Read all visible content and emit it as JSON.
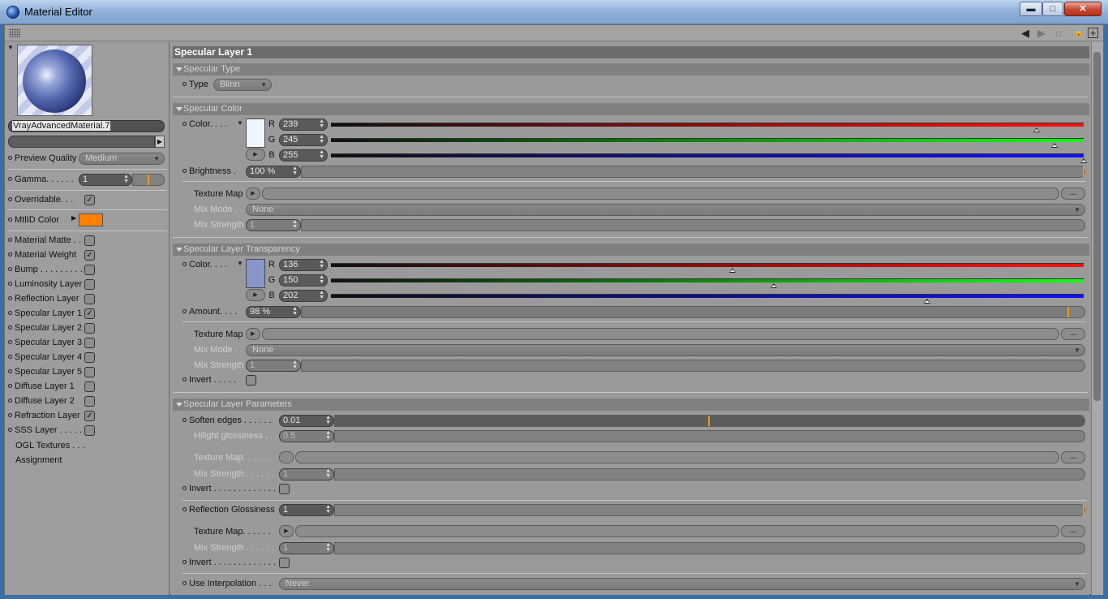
{
  "window": {
    "title": "Material Editor",
    "min_label": "▬",
    "max_label": "□",
    "close_label": "✕"
  },
  "toolbar": {
    "back_icon": "◀",
    "forward_icon": "▶",
    "home_icon": "⌂",
    "lock_icon": "🔒",
    "new_icon": "+"
  },
  "material": {
    "name": "VrayAdvancedMaterial.7"
  },
  "left": {
    "preview_quality_label": "Preview Quality",
    "preview_quality_value": "Medium",
    "gamma_label": "Gamma. . . . . .",
    "gamma_value": "1",
    "overridable_label": "Overridable. . .",
    "mtlid_label": "MtlID Color",
    "mtlid_color": "#ff8000",
    "channels": [
      {
        "label": "Material Matte  . .",
        "checked": false
      },
      {
        "label": "Material Weight",
        "checked": true
      },
      {
        "label": "Bump . . . . . . . . . .",
        "checked": false
      },
      {
        "label": "Luminosity Layer",
        "checked": false
      },
      {
        "label": "Reflection Layer",
        "checked": false
      },
      {
        "label": "Specular Layer 1",
        "checked": true
      },
      {
        "label": "Specular Layer 2",
        "checked": false
      },
      {
        "label": "Specular Layer 3",
        "checked": false
      },
      {
        "label": "Specular Layer 4",
        "checked": false
      },
      {
        "label": "Specular Layer 5",
        "checked": false
      },
      {
        "label": "Diffuse Layer 1",
        "checked": false
      },
      {
        "label": "Diffuse Layer 2",
        "checked": false
      },
      {
        "label": "Refraction Layer",
        "checked": true
      },
      {
        "label": "SSS Layer . . . . .",
        "checked": false
      }
    ],
    "ogl_textures_label": "OGL Textures . . .",
    "assignment_label": "Assignment"
  },
  "panel": {
    "header": "Specular Layer 1",
    "spec_type": {
      "section": "Specular Type",
      "type_label": "Type",
      "type_value": "Blinn"
    },
    "spec_color": {
      "section": "Specular Color",
      "color_label": "Color. . . .",
      "swatch": "#eff5ff",
      "r_label": "R",
      "r_value": "239",
      "r_frac": 0.937,
      "g_label": "G",
      "g_value": "245",
      "g_frac": 0.961,
      "b_label": "B",
      "b_value": "255",
      "b_frac": 1.0,
      "brightness_label": "Brightness  .",
      "brightness_value": "100 %",
      "brightness_frac": 1.0,
      "texture_map_label": "Texture Map",
      "mix_mode_label": "Mix Mode . .",
      "mix_mode_value": "None",
      "mix_strength_label": "Mix Strength",
      "mix_strength_value": "1",
      "dots_label": "..."
    },
    "transparency": {
      "section": "Specular Layer Transparency",
      "color_label": "Color. . . .",
      "swatch": "#8896ca",
      "r_label": "R",
      "r_value": "136",
      "r_frac": 0.533,
      "g_label": "G",
      "g_value": "150",
      "g_frac": 0.588,
      "b_label": "B",
      "b_value": "202",
      "b_frac": 0.792,
      "amount_label": "Amount. . . .",
      "amount_value": "98 %",
      "amount_frac": 0.98,
      "texture_map_label": "Texture Map",
      "mix_mode_label": "Mix Mode . .",
      "mix_mode_value": "None",
      "mix_strength_label": "Mix Strength",
      "mix_strength_value": "1",
      "invert_label": "Invert . . . . .",
      "dots_label": "..."
    },
    "params": {
      "section": "Specular Layer Parameters",
      "soften_label": "Soften edges . . . . . .",
      "soften_value": "0.01",
      "soften_frac": 0.5,
      "hilight_label": "Hilight glossiness . . .",
      "hilight_value": "0.5",
      "tex_label": "Texture Map. . . . . .",
      "mixs_label": "Mix Strength . . . . . .",
      "mixs_value": "1",
      "invert_label": "Invert . . . . . . . . . . . . .",
      "refl_gloss_label": "Reflection Glossiness",
      "refl_gloss_value": "1",
      "tex2_label": "Texture Map. . . . . .",
      "mixs2_label": "Mix Strength . . . . . .",
      "mixs2_value": "1",
      "invert2_label": "Invert . . . . . . . . . . . . .",
      "interp_label": "Use Interpolation . . .",
      "interp_value": "Never",
      "dots_label": "..."
    }
  }
}
